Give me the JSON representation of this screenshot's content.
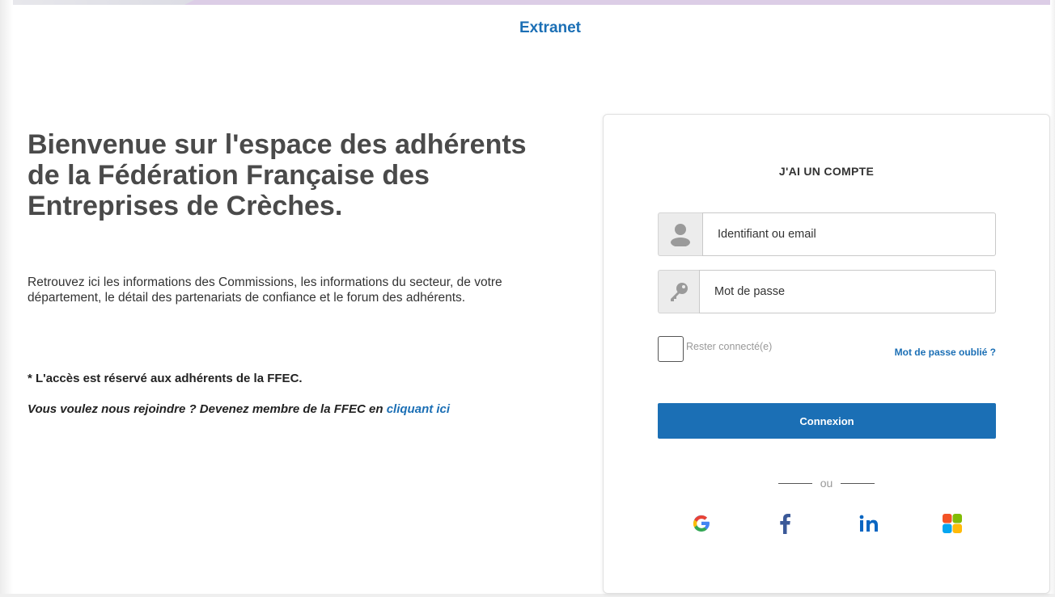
{
  "header": {
    "title": "Extranet"
  },
  "welcome": {
    "heading": "Bienvenue sur l'espace des adhérents de la Fédération Française des Entreprises de Crèches.",
    "intro": "Retrouvez ici les informations des Commissions, les informations du secteur, de votre département, le détail des partenariats de confiance et le forum des adhérents.",
    "access_note": "* L'accès est réservé aux adhérents de la FFEC.",
    "join_text": "Vous voulez nous rejoindre ? Devenez membre de la FFEC en ",
    "join_link": "cliquant ici"
  },
  "login": {
    "title": "J'AI UN COMPTE",
    "username_placeholder": "Identifiant ou email",
    "username_value": "",
    "password_placeholder": "Mot de passe",
    "password_value": "",
    "remember_label": "Rester connecté(e)",
    "remember_checked": false,
    "forgot_label": "Mot de passe oublié ?",
    "submit_label": "Connexion",
    "divider_text": "ou",
    "social_icons": [
      "google-icon",
      "facebook-icon",
      "linkedin-icon",
      "microsoft-icon"
    ]
  },
  "colors": {
    "brand_blue": "#1b6fb5",
    "heading_gray": "#4a4a4a",
    "addon_gray": "#ececec"
  }
}
